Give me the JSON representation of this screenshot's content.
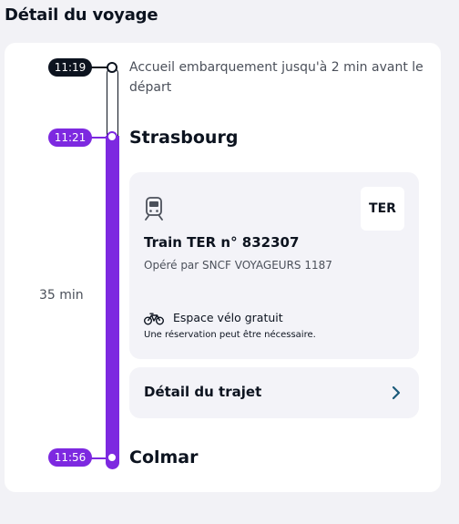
{
  "page": {
    "title": "Détail du voyage"
  },
  "timeline": {
    "boarding": {
      "time": "11:19",
      "text": "Accueil embarquement jusqu'à 2 min avant le départ"
    },
    "departure": {
      "time": "11:21",
      "station": "Strasbourg"
    },
    "duration": "35 min",
    "arrival": {
      "time": "11:56",
      "station": "Colmar"
    }
  },
  "train": {
    "icon": "train-icon",
    "badge": "TER",
    "name": "Train TER n° 832307",
    "operator": "Opéré par SNCF VOYAGEURS 1187",
    "bike": {
      "icon": "bike-icon",
      "label": "Espace vélo gratuit",
      "note": "Une réservation peut être nécessaire."
    }
  },
  "trip_detail": {
    "label": "Détail du trajet",
    "icon": "chevron-right-icon"
  },
  "colors": {
    "accent": "#7d29e0",
    "dark": "#0c131f",
    "card": "#f3f3f8",
    "background": "#f2f2f6",
    "chevron": "#1a5a7a"
  }
}
